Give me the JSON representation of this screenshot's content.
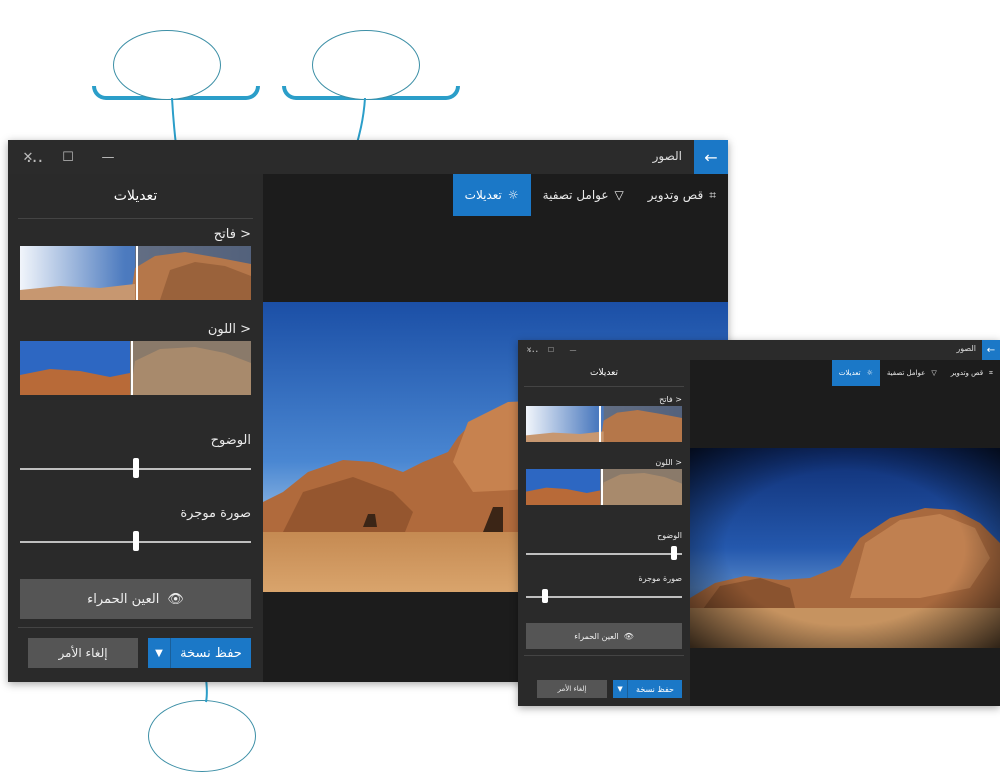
{
  "app": {
    "title": "الصور",
    "back_icon": "arrow-left-icon",
    "controls": [
      "close-icon",
      "maximize-icon",
      "minimize-icon"
    ]
  },
  "toolbar": {
    "crop_label": "قص وتدوير",
    "filters_label": "عوامل تصفية",
    "adjust_label": "تعديلات",
    "more_label": "..."
  },
  "panel": {
    "title": "تعديلات",
    "light_label": "فاتح",
    "color_label": "اللون",
    "clarity_label": "الوضوح",
    "vignette_label": "صورة موجرة",
    "redeye_label": "العين الحمراء",
    "save_label": "حفظ نسخة",
    "cancel_label": "إلغاء الأمر"
  },
  "values": {
    "big": {
      "light_marker": 0.5,
      "color_marker": 0.5,
      "clarity": 0.5,
      "vignette": 0.5
    },
    "small": {
      "light_marker": 0.5,
      "color_marker": 0.5,
      "clarity": 0.95,
      "vignette": 0.12
    }
  },
  "colors": {
    "accent": "#1b78c7",
    "panel": "#2a2a2a",
    "background": "#1c1c1c",
    "callout": "#2b9ec9"
  }
}
